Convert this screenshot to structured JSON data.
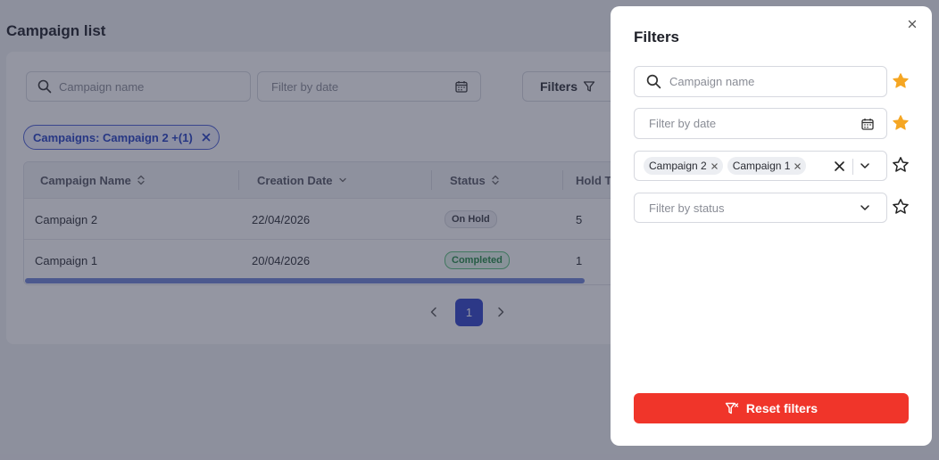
{
  "page": {
    "title": "Campaign list"
  },
  "toolbar": {
    "search_placeholder": "Campaign name",
    "date_placeholder": "Filter by date",
    "filters_label": "Filters"
  },
  "active_filter_chip": {
    "label": "Campaigns: Campaign 2 +(1)"
  },
  "table": {
    "columns": [
      "Campaign Name",
      "Creation Date",
      "Status",
      "Hold T"
    ],
    "rows": [
      {
        "name": "Campaign 2",
        "date": "22/04/2026",
        "status": "On Hold",
        "hold": "5"
      },
      {
        "name": "Campaign 1",
        "date": "20/04/2026",
        "status": "Completed",
        "hold": "1"
      }
    ]
  },
  "pagination": {
    "current_page": "1"
  },
  "drawer": {
    "title": "Filters",
    "campaign_name_placeholder": "Campaign name",
    "date_placeholder": "Filter by date",
    "selected_campaigns": [
      "Campaign 2",
      "Campaign 1"
    ],
    "status_placeholder": "Filter by status",
    "reset_label": "Reset filters",
    "favorites": [
      true,
      true,
      false,
      false
    ]
  },
  "colors": {
    "accent": "#2e43c8",
    "reset": "#f0352a",
    "star_filled": "#f5a623",
    "completed": "#238a45"
  }
}
